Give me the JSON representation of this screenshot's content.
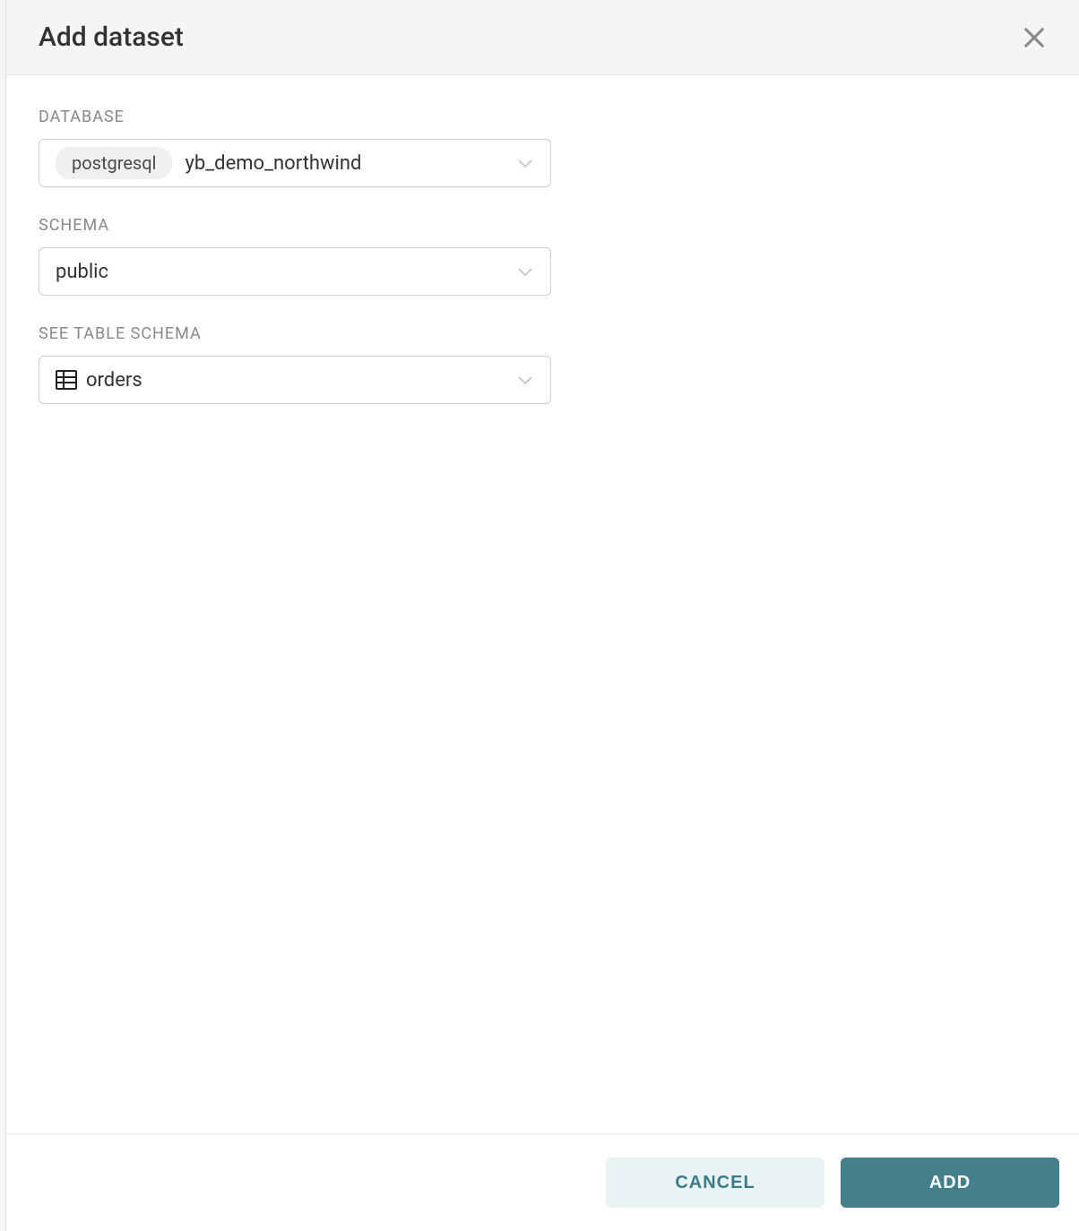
{
  "dialog": {
    "title": "Add dataset"
  },
  "fields": {
    "database": {
      "label": "DATABASE",
      "badge": "postgresql",
      "value": "yb_demo_northwind"
    },
    "schema": {
      "label": "SCHEMA",
      "value": "public"
    },
    "table": {
      "label": "SEE TABLE SCHEMA",
      "value": "orders"
    }
  },
  "footer": {
    "cancel_label": "CANCEL",
    "add_label": "ADD"
  }
}
